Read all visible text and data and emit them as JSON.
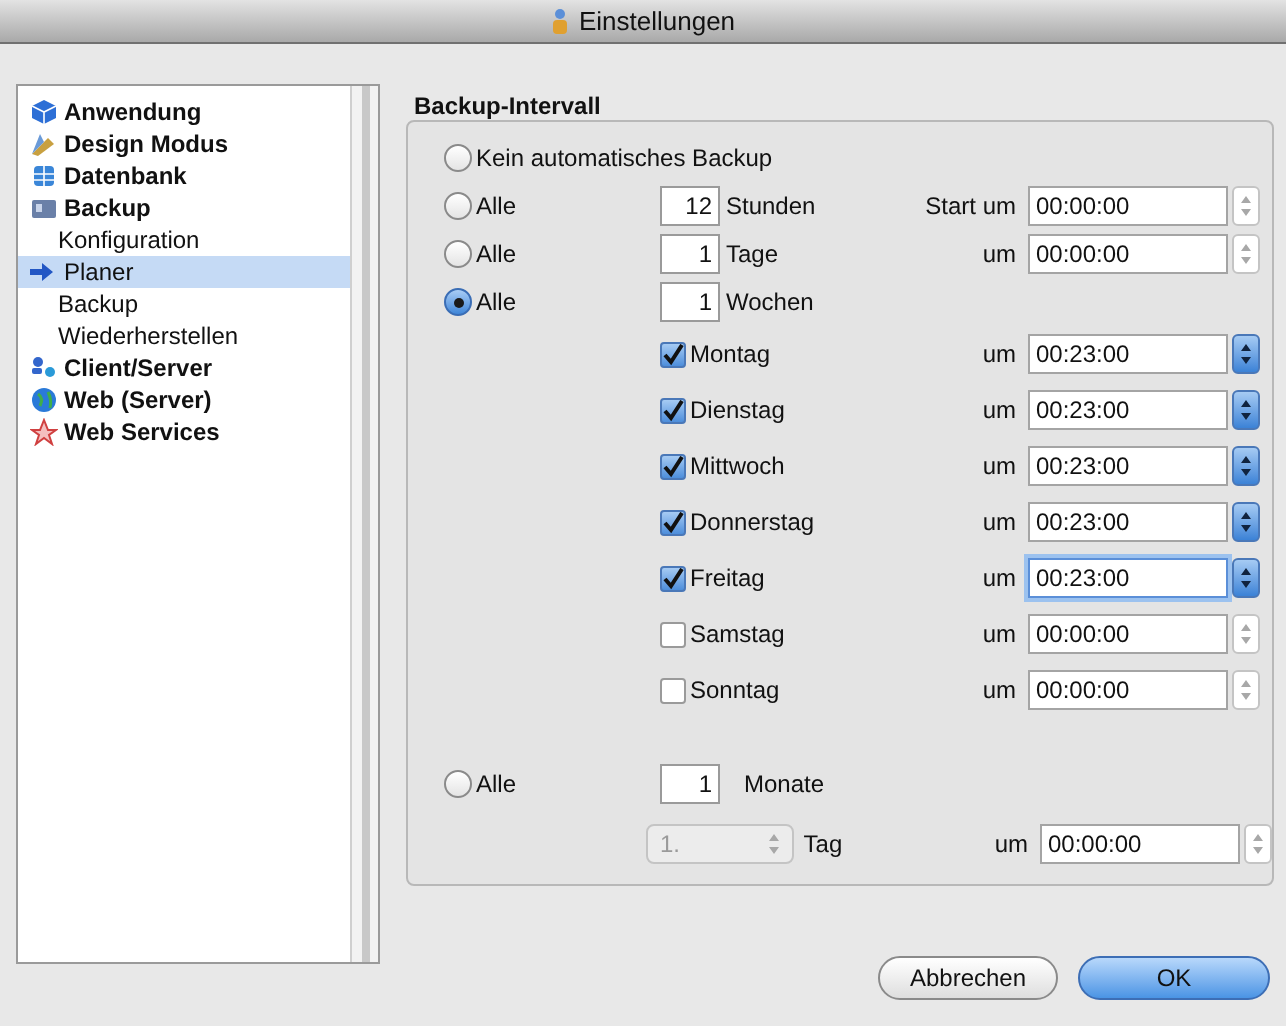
{
  "window": {
    "title": "Einstellungen"
  },
  "sidebar": {
    "items": [
      {
        "label": "Anwendung",
        "selected": false
      },
      {
        "label": "Design Modus",
        "selected": false
      },
      {
        "label": "Datenbank",
        "selected": false
      },
      {
        "label": "Backup",
        "selected": false,
        "children": [
          {
            "label": "Konfiguration",
            "selected": false
          },
          {
            "label": "Planer",
            "selected": true
          },
          {
            "label": "Backup",
            "selected": false
          },
          {
            "label": "Wiederherstellen",
            "selected": false
          }
        ]
      },
      {
        "label": "Client/Server",
        "selected": false
      },
      {
        "label": "Web (Server)",
        "selected": false
      },
      {
        "label": "Web Services",
        "selected": false
      }
    ]
  },
  "group": {
    "title": "Backup-Intervall",
    "intervals": [
      {
        "kind": "none",
        "label": "Kein automatisches Backup",
        "selected": false
      },
      {
        "kind": "count",
        "label": "Alle",
        "selected": false,
        "value": "12",
        "unit": "Stunden",
        "time_label": "Start um",
        "time": "00:00:00"
      },
      {
        "kind": "count",
        "label": "Alle",
        "selected": false,
        "value": "1",
        "unit": "Tage",
        "time_label": "um",
        "time": "00:00:00"
      },
      {
        "kind": "weekly",
        "label": "Alle",
        "selected": true,
        "value": "1",
        "unit": "Wochen",
        "days": [
          {
            "label": "Montag",
            "checked": true,
            "time_label": "um",
            "time": "00:23:00",
            "focused": false
          },
          {
            "label": "Dienstag",
            "checked": true,
            "time_label": "um",
            "time": "00:23:00",
            "focused": false
          },
          {
            "label": "Mittwoch",
            "checked": true,
            "time_label": "um",
            "time": "00:23:00",
            "focused": false
          },
          {
            "label": "Donnerstag",
            "checked": true,
            "time_label": "um",
            "time": "00:23:00",
            "focused": false
          },
          {
            "label": "Freitag",
            "checked": true,
            "time_label": "um",
            "time": "00:23:00",
            "focused": true
          },
          {
            "label": "Samstag",
            "checked": false,
            "time_label": "um",
            "time": "00:00:00",
            "focused": false
          },
          {
            "label": "Sonntag",
            "checked": false,
            "time_label": "um",
            "time": "00:00:00",
            "focused": false
          }
        ]
      },
      {
        "kind": "monthly",
        "label": "Alle",
        "selected": false,
        "value": "1",
        "unit": "Monate",
        "day_select": "1.",
        "day_unit": "Tag",
        "time_label": "um",
        "time": "00:00:00"
      }
    ]
  },
  "buttons": [
    {
      "label": "Abbrechen",
      "default": false
    },
    {
      "label": "OK",
      "default": true
    }
  ]
}
